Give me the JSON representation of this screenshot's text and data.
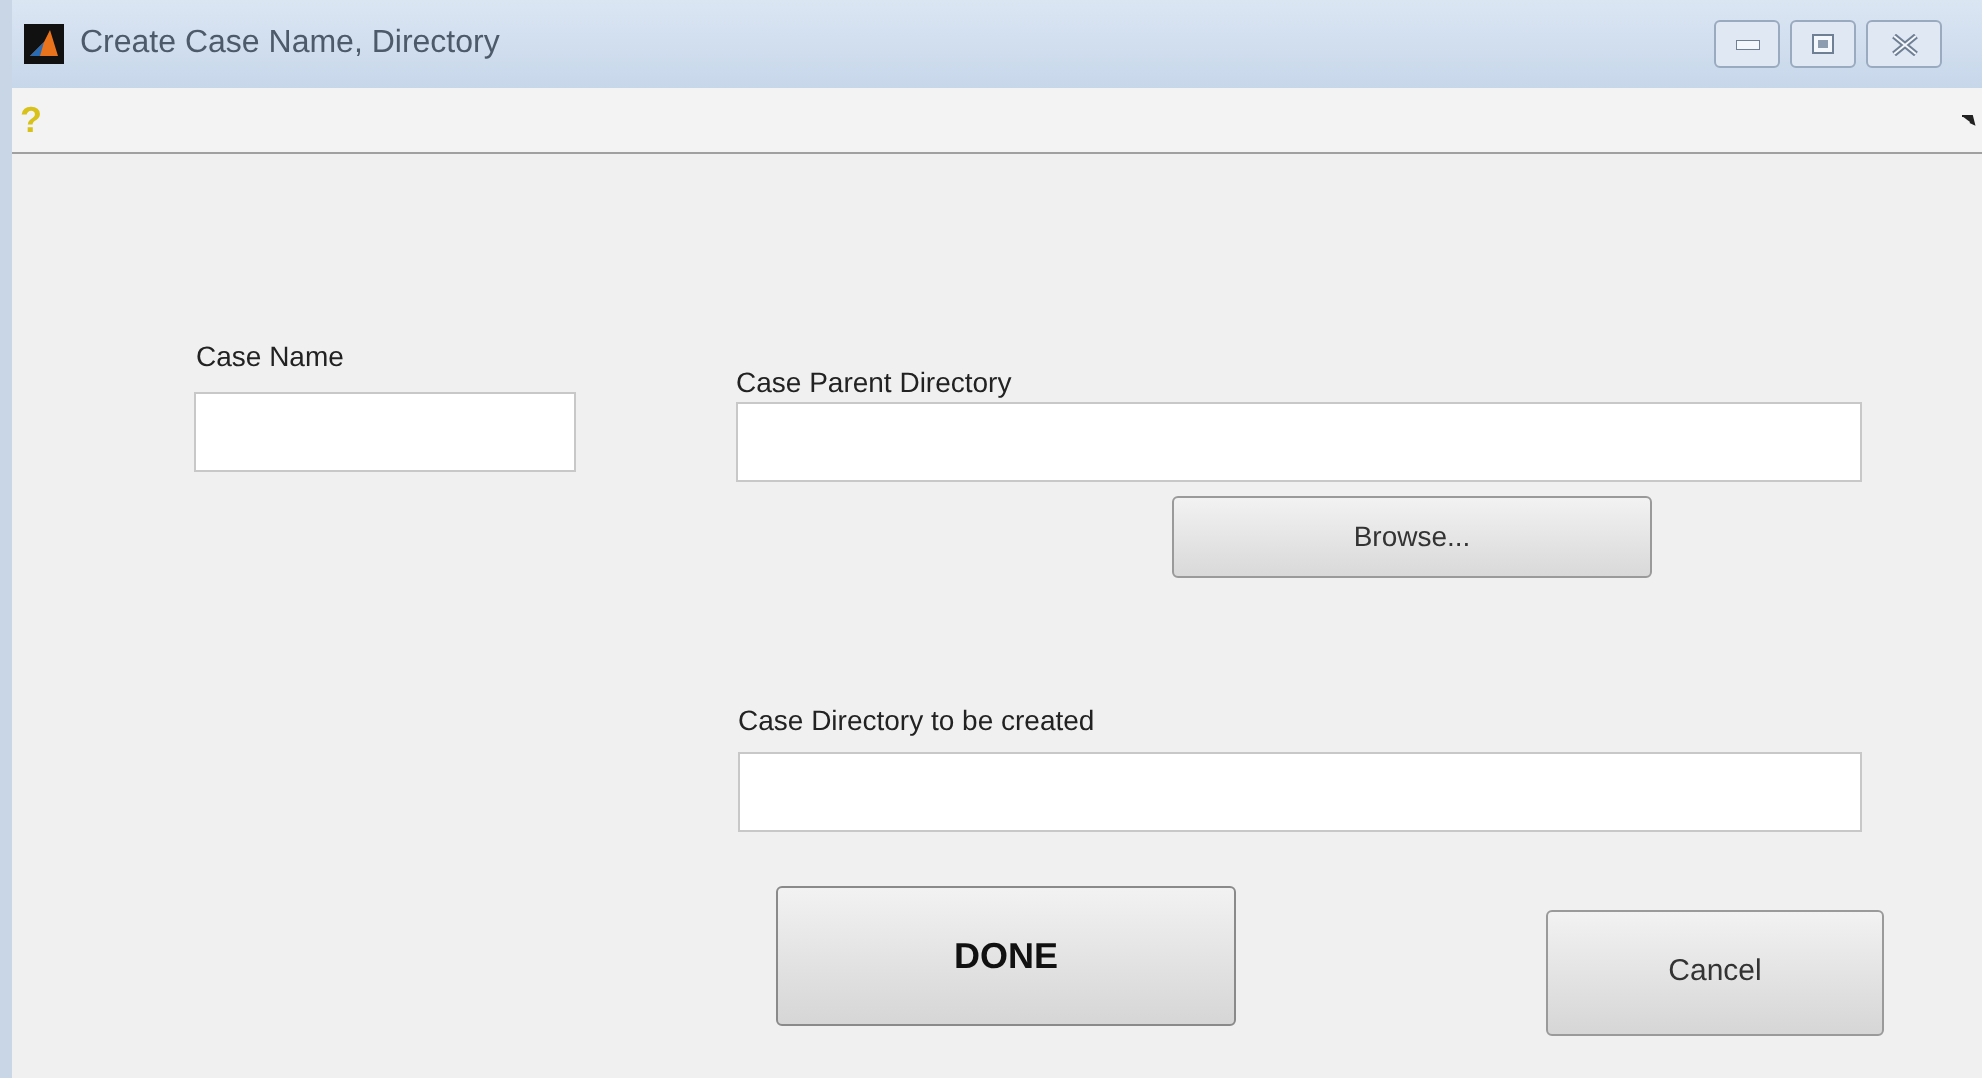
{
  "window": {
    "title": "Create Case Name, Directory"
  },
  "toolbar": {
    "help_button": "?"
  },
  "labels": [
    "Case Name",
    "Case Parent Directory",
    "Case Directory to be created"
  ],
  "buttons": {
    "browse": "Browse...",
    "done": "DONE",
    "cancel": "Cancel"
  }
}
